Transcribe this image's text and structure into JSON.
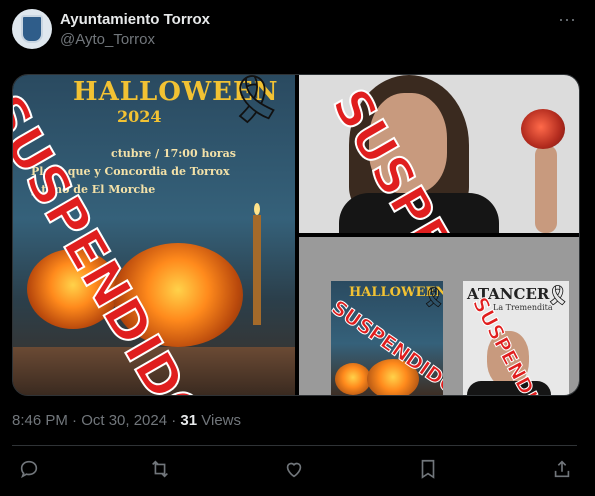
{
  "account": {
    "name": "Ayuntamiento Torrox",
    "handle": "@Ayto_Torrox"
  },
  "menu_icon": "more-dots-icon",
  "media": {
    "poster_halloween": {
      "title": "HALLOWEEN",
      "year": "2024",
      "line1": "ctubre / 17:00 horas",
      "line2": "Plaza      que y Concordia de Torrox",
      "line3": "y          timo de El Morche",
      "stamp": "SUSPENDIDO"
    },
    "photo_person": {
      "stamp": "SUSPENDIDO"
    },
    "collage": {
      "mini_halloween_title": "HALLOWEEN",
      "mini_halloween_stamp": "SUSPENDIDO",
      "mini_poster_title": "ATANCER",
      "mini_poster_sub": "La Tremendita",
      "mini_poster_stamp": "SUSPENDIDO"
    }
  },
  "meta": {
    "time": "8:46 PM · Oct 30, 2024 · ",
    "views_count": "31",
    "views_label": " Views"
  },
  "actions": [
    "reply-icon",
    "retweet-icon",
    "like-icon",
    "bookmark-icon",
    "share-icon"
  ],
  "colors": {
    "background": "#000000",
    "text_primary": "#e7e9ea",
    "text_secondary": "#71767b",
    "stamp_red": "#e01e1e"
  }
}
